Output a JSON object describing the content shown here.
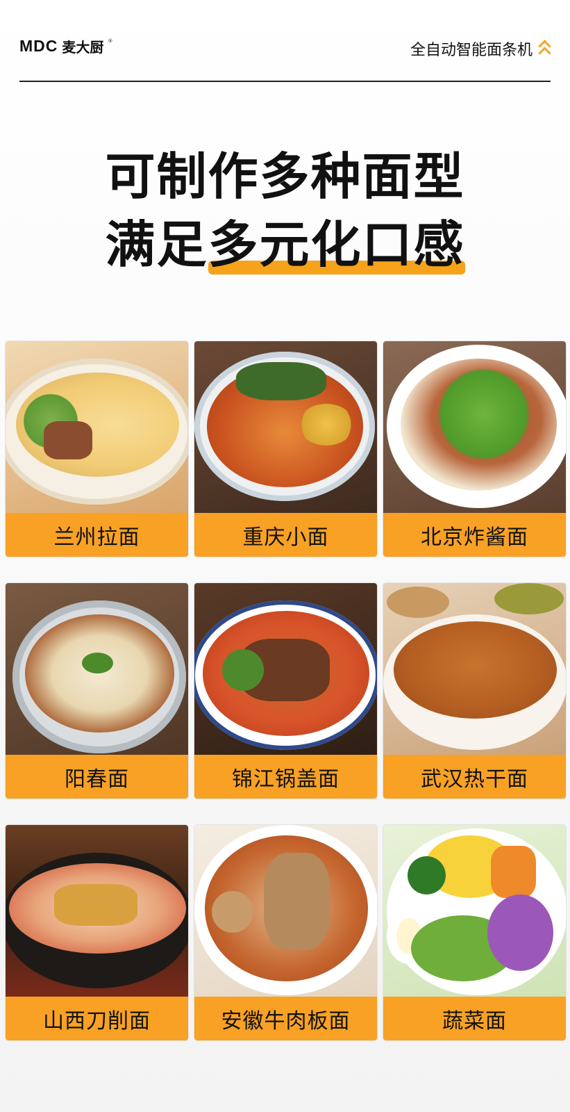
{
  "header": {
    "logo_mark": "MDC",
    "logo_cn": "麦大厨",
    "logo_reg": "®",
    "tagline": "全自动智能面条机"
  },
  "headline": {
    "line1": "可制作多种面型",
    "line2_prefix": "满足",
    "line2_highlight": "多元化口感"
  },
  "colors": {
    "accent": "#f8a124",
    "text": "#111111"
  },
  "noodles": [
    {
      "label": "兰州拉面",
      "icon": "lanzhou-noodle-photo"
    },
    {
      "label": "重庆小面",
      "icon": "chongqing-noodle-photo"
    },
    {
      "label": "北京炸酱面",
      "icon": "zhajiang-noodle-photo"
    },
    {
      "label": "阳春面",
      "icon": "yangchun-noodle-photo"
    },
    {
      "label": "锦江锅盖面",
      "icon": "guogai-noodle-photo"
    },
    {
      "label": "武汉热干面",
      "icon": "reganmian-photo"
    },
    {
      "label": "山西刀削面",
      "icon": "daoxiao-noodle-photo"
    },
    {
      "label": "安徽牛肉板面",
      "icon": "banmian-photo"
    },
    {
      "label": "蔬菜面",
      "icon": "vegetable-noodle-photo"
    }
  ]
}
